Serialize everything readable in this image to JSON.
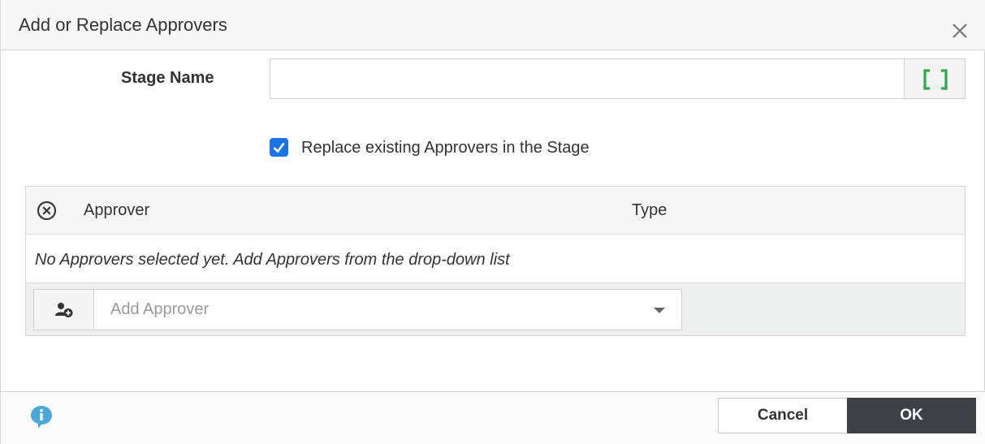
{
  "dialog": {
    "title": "Add or Replace Approvers",
    "close_icon": "close-icon"
  },
  "stage": {
    "label": "Stage Name",
    "value": "",
    "variable_button_icon": "brackets-icon",
    "variable_button_color": "#2ea84a"
  },
  "replace": {
    "label": "Replace existing Approvers in the Stage",
    "checked": true,
    "accent": "#1b73e8"
  },
  "table": {
    "clear_icon": "clear-all-icon",
    "columns": [
      "Approver",
      "Type"
    ],
    "empty_message": "No Approvers selected yet. Add Approvers from the drop-down list",
    "add_icon": "add-user-icon",
    "add_placeholder": "Add Approver"
  },
  "footer": {
    "info_icon": "info-icon",
    "info_color": "#4aa8d8",
    "cancel_label": "Cancel",
    "ok_label": "OK"
  }
}
